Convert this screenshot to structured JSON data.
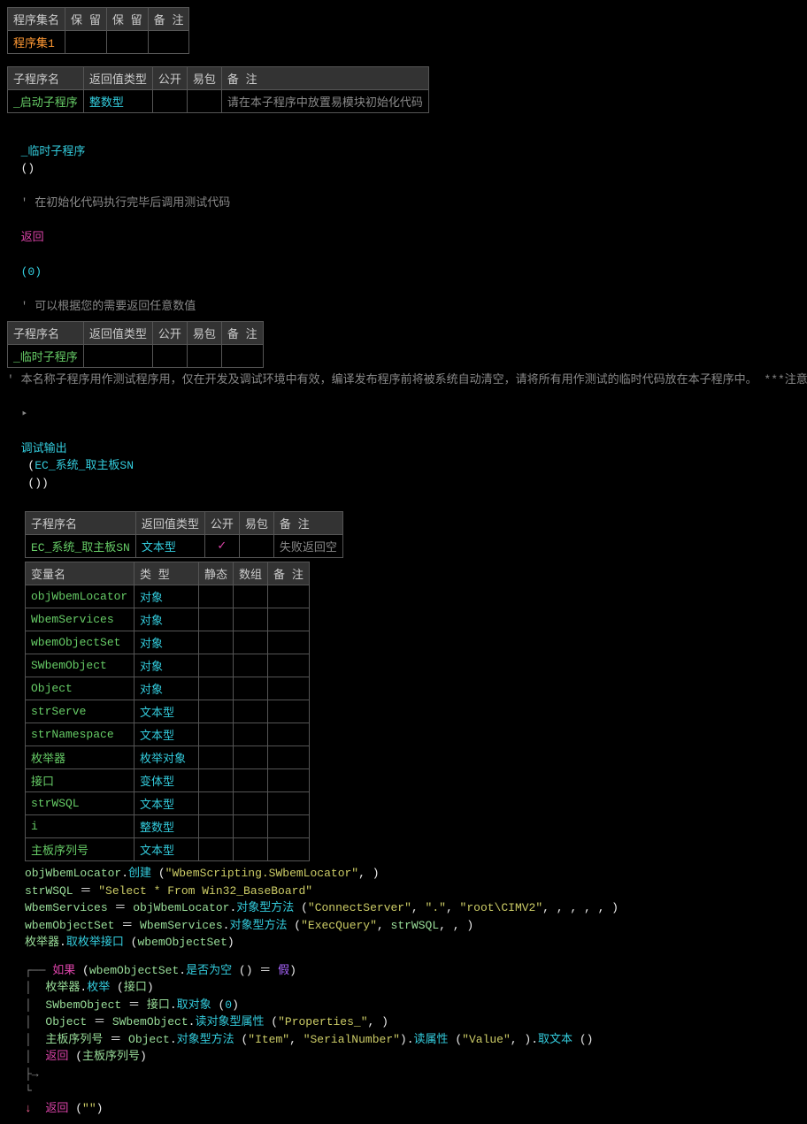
{
  "table1": {
    "headers": [
      "程序集名",
      "保 留",
      "保 留",
      "备 注"
    ],
    "row": [
      "程序集1",
      "",
      "",
      ""
    ]
  },
  "table2": {
    "headers": [
      "子程序名",
      "返回值类型",
      "公开",
      "易包",
      "备 注"
    ],
    "row": {
      "name": "_启动子程序",
      "type": "整数型",
      "remark": "请在本子程序中放置易模块初始化代码"
    }
  },
  "line_temp": {
    "func": "_临时子程序",
    "paren": "()",
    "comment": "' 在初始化代码执行完毕后调用测试代码"
  },
  "line_return": {
    "kw": "返回",
    "val": "(0)",
    "comment": "' 可以根据您的需要返回任意数值"
  },
  "table3": {
    "headers": [
      "子程序名",
      "返回值类型",
      "公开",
      "易包",
      "备 注"
    ],
    "row": {
      "name": "_临时子程序"
    }
  },
  "comment_long": "' 本名称子程序用作测试程序用，仅在开发及调试环境中有效，编译发布程序前将被系统自动清空，请将所有用作测试的临时代码放在本子程序中。 ***注意不要修改本",
  "debug_line": {
    "arrow": "‣",
    "kw": "调试输出",
    "open": "(",
    "fn": "EC_系统_取主板SN",
    "paren": "()",
    ")": ")"
  },
  "table_sub": {
    "headers": [
      "子程序名",
      "返回值类型",
      "公开",
      "易包",
      "备 注"
    ],
    "row": {
      "name": "EC_系统_取主板SN",
      "type": "文本型",
      "check": "✓",
      "remark": "失败返回空"
    }
  },
  "table_vars": {
    "headers": [
      "变量名",
      "类 型",
      "静态",
      "数组",
      "备 注"
    ],
    "rows": [
      {
        "name": "objWbemLocator",
        "type": "对象"
      },
      {
        "name": "WbemServices",
        "type": "对象"
      },
      {
        "name": "wbemObjectSet",
        "type": "对象"
      },
      {
        "name": "SWbemObject",
        "type": "对象"
      },
      {
        "name": "Object",
        "type": "对象"
      },
      {
        "name": "strServe",
        "type": "文本型"
      },
      {
        "name": "strNamespace",
        "type": "文本型"
      },
      {
        "name": "枚举器",
        "type": "枚举对象"
      },
      {
        "name": "接口",
        "type": "变体型"
      },
      {
        "name": "strWSQL",
        "type": "文本型"
      },
      {
        "name": "i",
        "type": "整数型"
      },
      {
        "name": "主板序列号",
        "type": "文本型"
      }
    ]
  },
  "code": {
    "l1": {
      "a": "objWbemLocator",
      "b": ".",
      "c": "创建",
      "d": " (",
      "e": "\"WbemScripting.SWbemLocator\"",
      "f": ", )"
    },
    "l2": {
      "a": "strWSQL",
      "b": " ＝ ",
      "c": "\"Select * From Win32_BaseBoard\""
    },
    "l3": {
      "a": "WbemServices",
      "b": " ＝ ",
      "c": "objWbemLocator",
      "d": ".",
      "e": "对象型方法",
      "f": " (",
      "g": "\"ConnectServer\"",
      "h": ", ",
      "i": "\".\"",
      "j": ", ",
      "k": "\"root\\CIMV2\"",
      "l": ", , , , , )"
    },
    "l4": {
      "a": "wbemObjectSet",
      "b": " ＝ ",
      "c": "WbemServices",
      "d": ".",
      "e": "对象型方法",
      "f": " (",
      "g": "\"ExecQuery\"",
      "h": ", ",
      "i": "strWSQL",
      "j": ", , )"
    },
    "l5": {
      "a": "枚举器",
      "b": ".",
      "c": "取枚举接口",
      "d": " (",
      "e": "wbemObjectSet",
      "f": ")"
    },
    "if": {
      "kw": "如果",
      "open": " (",
      "a": "wbemObjectSet",
      "dot": ".",
      "b": "是否为空",
      "paren": " ()",
      " eq": " ＝ ",
      "val": "假",
      "close": ")"
    },
    "b1": {
      "a": "枚举器",
      "dot": ".",
      "b": "枚举",
      "open": " (",
      "c": "接口",
      "close": ")"
    },
    "b2": {
      "a": "SWbemObject",
      "eq": " ＝ ",
      "b": "接口",
      "dot": ".",
      "c": "取对象",
      "open": " (",
      "d": "0",
      "close": ")"
    },
    "b3": {
      "a": "Object",
      "eq": " ＝ ",
      "b": "SWbemObject",
      "dot": ".",
      "c": "读对象型属性",
      "open": " (",
      "d": "\"Properties_\"",
      "close": ", )"
    },
    "b4": {
      "a": "主板序列号",
      "eq": " ＝ ",
      "b": "Object",
      "dot": ".",
      "c": "对象型方法",
      "open": " (",
      "d": "\"Item\"",
      "comma": ", ",
      "e": "\"SerialNumber\"",
      "close": ")",
      "dot2": ".",
      "f": "读属性",
      "open2": " (",
      "g": "\"Value\"",
      "close2": ", )",
      "dot3": ".",
      "h": "取文本",
      "paren": " ()"
    },
    "b5": {
      "kw": "返回",
      "open": " (",
      "a": "主板序列号",
      "close": ")"
    },
    "else_ret": {
      "kw": "返回",
      "open": " (",
      "a": "\"\"",
      "close": ")"
    }
  },
  "tree": {
    "top": "┌──",
    "mid": "│",
    "branch": "├→",
    "bot": "└"
  }
}
